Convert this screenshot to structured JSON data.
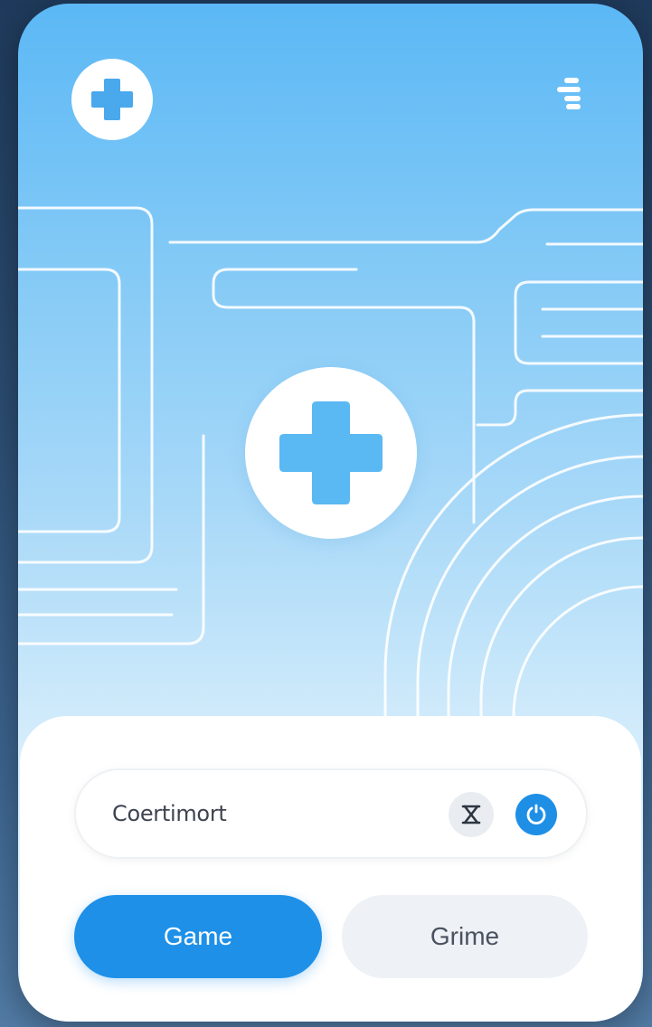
{
  "colors": {
    "accent": "#1e90e8",
    "plus_blue": "#5ab8f2",
    "sky_top": "#5bb8f5",
    "sky_bottom": "#eef7fd"
  },
  "header": {
    "logo_icon": "plus-icon",
    "menu_icon": "menu-icon"
  },
  "hero": {
    "badge_icon": "plus-icon"
  },
  "search": {
    "value": "Coertimort",
    "clear_icon": "hourglass-icon",
    "action_icon": "power-icon"
  },
  "actions": {
    "primary_label": "Game",
    "secondary_label": "Grime"
  }
}
